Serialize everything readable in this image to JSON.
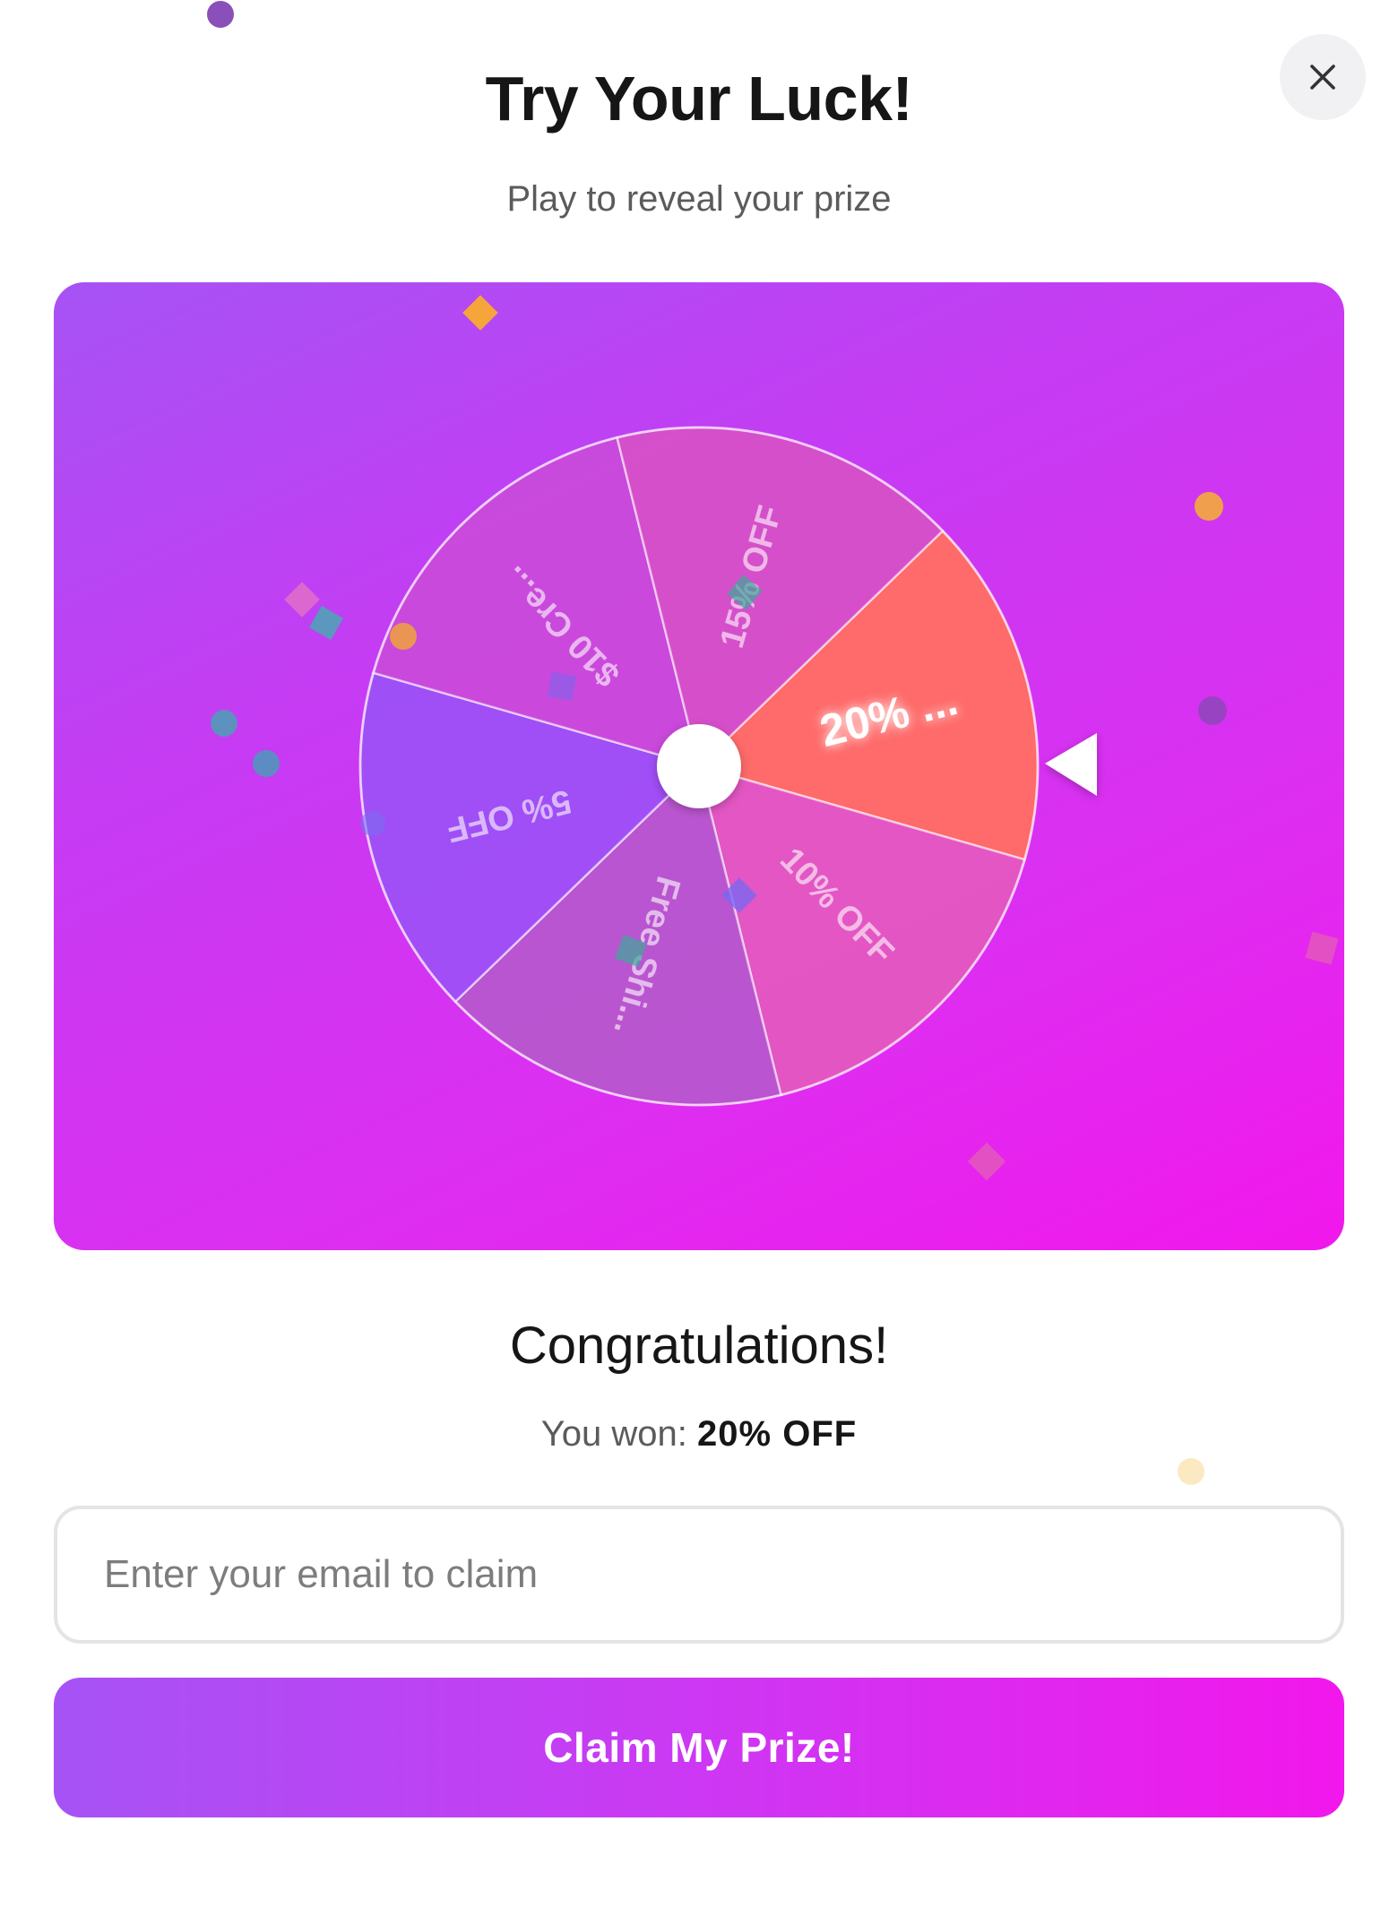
{
  "header": {
    "title": "Try Your Luck!",
    "subtitle": "Play to reveal your prize",
    "close_icon": "close-icon"
  },
  "wheel": {
    "segments": [
      {
        "label": "20% ...",
        "color": "#ff6a6a",
        "selected": true
      },
      {
        "label": "10% OFF",
        "color": "#e55bbd",
        "selected": false
      },
      {
        "label": "Free Shi...",
        "color": "#b55acb",
        "selected": false
      },
      {
        "label": "5% OFF",
        "color": "#9a52f6",
        "selected": false
      },
      {
        "label": "$10 Cre...",
        "color": "#c94bd8",
        "selected": false
      },
      {
        "label": "15% OFF",
        "color": "#d752c4",
        "selected": false
      }
    ],
    "pointer_icon": "pointer-triangle-icon"
  },
  "result": {
    "title": "Congratulations!",
    "won_label": "You won:",
    "prize": "20% OFF"
  },
  "form": {
    "email_placeholder": "Enter your email to claim",
    "email_value": "",
    "claim_label": "Claim My Prize!"
  },
  "colors": {
    "gradient_start": "#a653f5",
    "gradient_end": "#f217ec",
    "winning_segment": "#ff6a6a"
  }
}
